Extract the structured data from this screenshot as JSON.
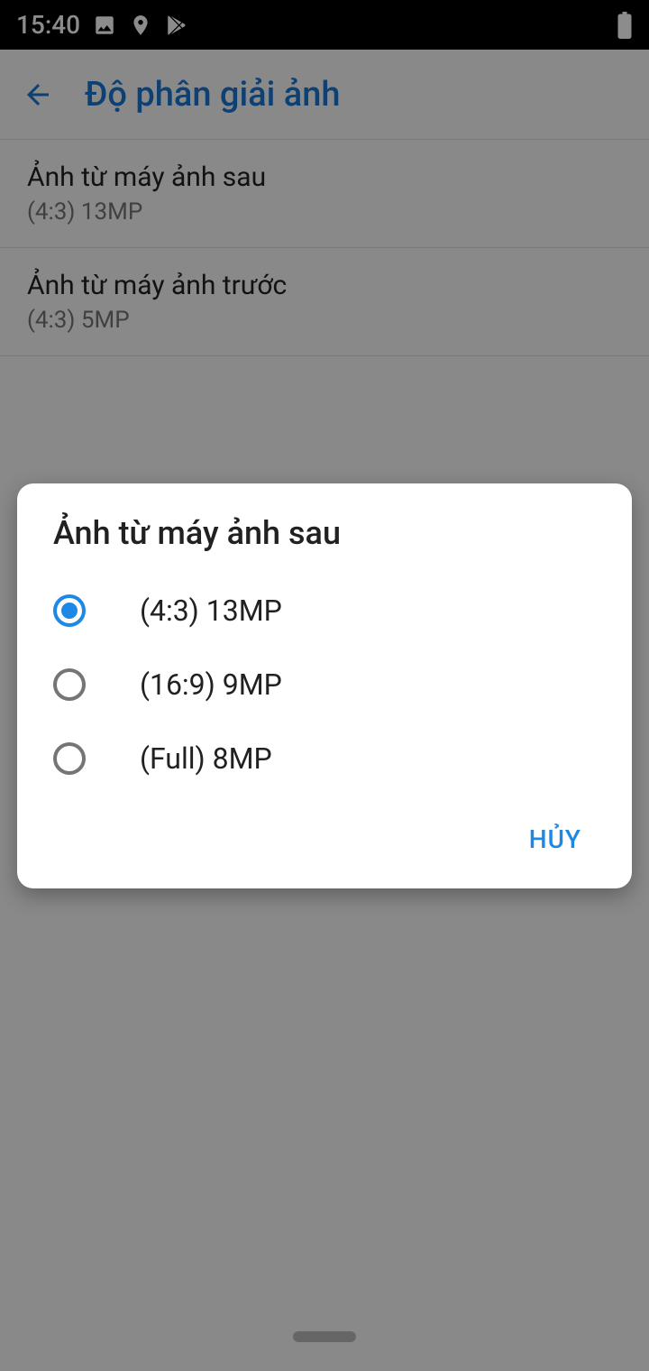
{
  "statusbar": {
    "time": "15:40"
  },
  "header": {
    "title": "Độ phân giải ảnh"
  },
  "settings": [
    {
      "title": "Ảnh từ máy ảnh sau",
      "value": "(4:3) 13MP"
    },
    {
      "title": "Ảnh từ máy ảnh trước",
      "value": "(4:3) 5MP"
    }
  ],
  "dialog": {
    "title": "Ảnh từ máy ảnh sau",
    "options": [
      {
        "label": "(4:3) 13MP",
        "selected": true
      },
      {
        "label": "(16:9) 9MP",
        "selected": false
      },
      {
        "label": "(Full) 8MP",
        "selected": false
      }
    ],
    "cancel": "HỦY"
  }
}
